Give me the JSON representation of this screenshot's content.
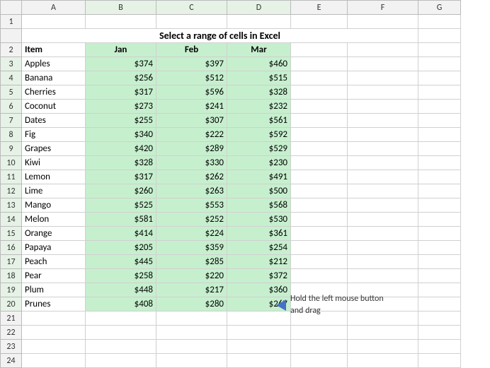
{
  "title": "Select a range of cells in Excel",
  "columns": {
    "row": "",
    "a": "A",
    "b": "B",
    "c": "C",
    "d": "D",
    "e": "E",
    "f": "F",
    "g": "G"
  },
  "headers": {
    "item": "Item",
    "jan": "Jan",
    "feb": "Feb",
    "mar": "Mar"
  },
  "rows": [
    {
      "num": 3,
      "item": "Apples",
      "jan": "$374",
      "feb": "$397",
      "mar": "$460"
    },
    {
      "num": 4,
      "item": "Banana",
      "jan": "$256",
      "feb": "$512",
      "mar": "$515"
    },
    {
      "num": 5,
      "item": "Cherries",
      "jan": "$317",
      "feb": "$596",
      "mar": "$328"
    },
    {
      "num": 6,
      "item": "Coconut",
      "jan": "$273",
      "feb": "$241",
      "mar": "$232"
    },
    {
      "num": 7,
      "item": "Dates",
      "jan": "$255",
      "feb": "$307",
      "mar": "$561"
    },
    {
      "num": 8,
      "item": "Fig",
      "jan": "$340",
      "feb": "$222",
      "mar": "$592"
    },
    {
      "num": 9,
      "item": "Grapes",
      "jan": "$420",
      "feb": "$289",
      "mar": "$529"
    },
    {
      "num": 10,
      "item": "Kiwi",
      "jan": "$328",
      "feb": "$330",
      "mar": "$230"
    },
    {
      "num": 11,
      "item": "Lemon",
      "jan": "$317",
      "feb": "$262",
      "mar": "$491"
    },
    {
      "num": 12,
      "item": "Lime",
      "jan": "$260",
      "feb": "$263",
      "mar": "$500"
    },
    {
      "num": 13,
      "item": "Mango",
      "jan": "$525",
      "feb": "$553",
      "mar": "$568"
    },
    {
      "num": 14,
      "item": "Melon",
      "jan": "$581",
      "feb": "$252",
      "mar": "$530"
    },
    {
      "num": 15,
      "item": "Orange",
      "jan": "$414",
      "feb": "$224",
      "mar": "$361"
    },
    {
      "num": 16,
      "item": "Papaya",
      "jan": "$205",
      "feb": "$359",
      "mar": "$254"
    },
    {
      "num": 17,
      "item": "Peach",
      "jan": "$445",
      "feb": "$285",
      "mar": "$212"
    },
    {
      "num": 18,
      "item": "Pear",
      "jan": "$258",
      "feb": "$220",
      "mar": "$372"
    },
    {
      "num": 19,
      "item": "Plum",
      "jan": "$448",
      "feb": "$217",
      "mar": "$360"
    },
    {
      "num": 20,
      "item": "Prunes",
      "jan": "$408",
      "feb": "$280",
      "mar": "$267"
    }
  ],
  "annotation": {
    "text_line1": "Hold the left mouse button",
    "text_line2": "and drag"
  },
  "empty_rows": [
    21,
    22,
    23,
    24
  ]
}
